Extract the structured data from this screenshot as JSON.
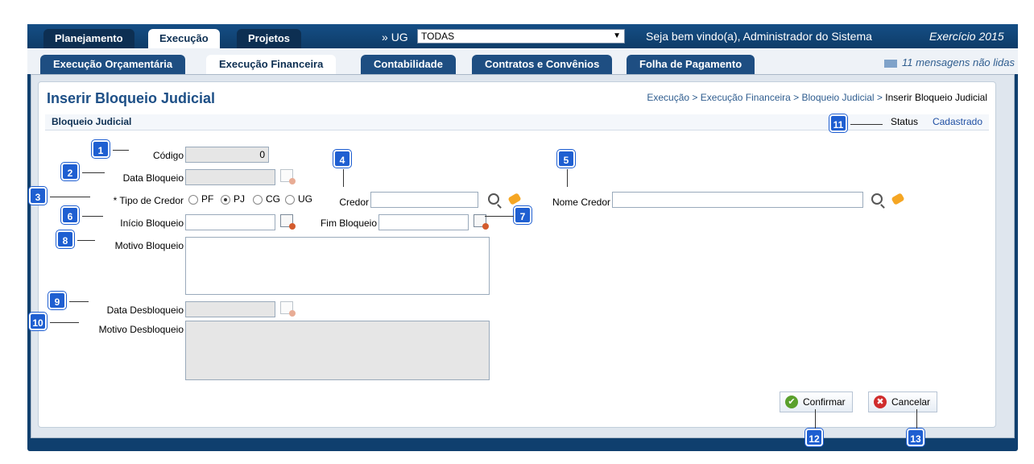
{
  "top_nav": {
    "tabs": [
      {
        "label": "Planejamento"
      },
      {
        "label": "Execução"
      },
      {
        "label": "Projetos"
      }
    ],
    "ug_prefix": "»",
    "ug_label": "UG",
    "ug_selected": "TODAS",
    "welcome": "Seja bem vindo(a), Administrador do Sistema",
    "exercicio": "Exercício 2015"
  },
  "sub_nav": {
    "tabs": [
      {
        "label": "Execução Orçamentária"
      },
      {
        "label": "Execução Financeira"
      },
      {
        "label": "Contabilidade"
      },
      {
        "label": "Contratos e Convênios"
      },
      {
        "label": "Folha de Pagamento"
      }
    ],
    "messages": "11 mensagens não lidas"
  },
  "page": {
    "title": "Inserir Bloqueio Judicial",
    "breadcrumb": [
      "Execução",
      "Execução Financeira",
      "Bloqueio Judicial",
      "Inserir Bloqueio Judicial"
    ],
    "section": "Bloqueio Judicial",
    "status_label": "Status",
    "status_value": "Cadastrado"
  },
  "form": {
    "codigo_label": "Código",
    "codigo_value": "0",
    "data_bloqueio_label": "Data Bloqueio",
    "tipo_credor_label": "* Tipo de Credor",
    "tipo_options": [
      "PF",
      "PJ",
      "CG",
      "UG"
    ],
    "tipo_selected": "PJ",
    "credor_label": "Credor",
    "nome_credor_label": "Nome Credor",
    "inicio_bloqueio_label": "Início Bloqueio",
    "fim_bloqueio_label": "Fim Bloqueio",
    "motivo_bloqueio_label": "Motivo Bloqueio",
    "data_desbloqueio_label": "Data Desbloqueio",
    "motivo_desbloqueio_label": "Motivo Desbloqueio"
  },
  "buttons": {
    "confirm": "Confirmar",
    "cancel": "Cancelar"
  },
  "callouts": [
    "1",
    "2",
    "3",
    "4",
    "5",
    "6",
    "7",
    "8",
    "9",
    "10",
    "11",
    "12",
    "13"
  ]
}
